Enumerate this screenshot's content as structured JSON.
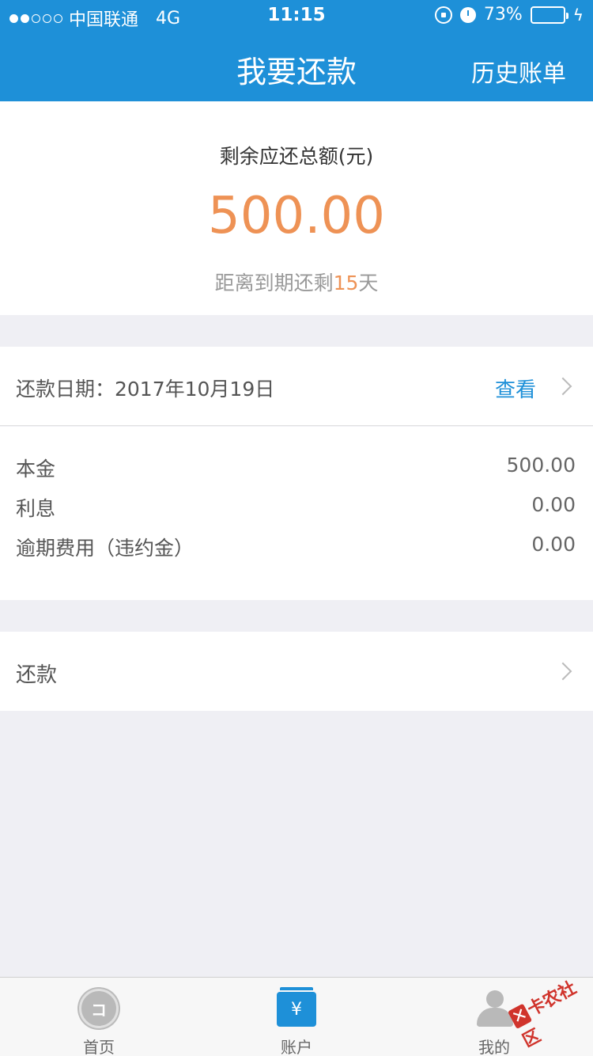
{
  "status_bar": {
    "carrier": "中国联通",
    "network": "4G",
    "time": "11:15",
    "battery": "73%",
    "battery_level": 0.73
  },
  "nav": {
    "title": "我要还款",
    "right_link": "历史账单"
  },
  "summary": {
    "label": "剩余应还总额(元)",
    "amount": "500.00",
    "due_prefix": "距离到期还剩",
    "due_days": "15",
    "due_suffix": "天"
  },
  "date_row": {
    "label": "还款日期：2017年10月19日",
    "action": "查看"
  },
  "details": [
    {
      "key": "本金",
      "value": "500.00"
    },
    {
      "key": "利息",
      "value": "0.00"
    },
    {
      "key": "逾期费用（违约金）",
      "value": "0.00"
    }
  ],
  "repay": {
    "label": "还款"
  },
  "tabbar": {
    "tabs": [
      {
        "label": "首页",
        "icon": "home-icon"
      },
      {
        "label": "账户",
        "icon": "account-icon"
      },
      {
        "label": "我的",
        "icon": "profile-icon"
      }
    ]
  },
  "watermark": "卡农社区",
  "colors": {
    "primary": "#1e90d8",
    "accent": "#ee9255"
  }
}
